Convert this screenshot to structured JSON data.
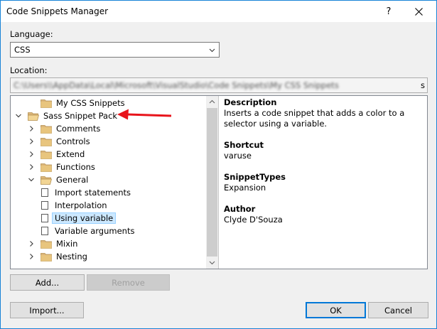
{
  "window": {
    "title": "Code Snippets Manager",
    "help_glyph": "?",
    "border_color": "#1883d7"
  },
  "language": {
    "label": "Language:",
    "selected": "CSS"
  },
  "location": {
    "label": "Location:",
    "value_blurred": "C:\\Users\\\\AppData\\Local\\Microsoft\\VisualStudio\\Code Snippets\\My CSS Snippets",
    "visible_end": "s"
  },
  "tree": {
    "items": [
      {
        "label": "My CSS Snippets",
        "type": "folder",
        "level": 1,
        "expander": "none"
      },
      {
        "label": "Sass Snippet Pack",
        "type": "folder-open",
        "level": 0,
        "expander": "expanded"
      },
      {
        "label": "Comments",
        "type": "folder",
        "level": 1,
        "expander": "collapsed"
      },
      {
        "label": "Controls",
        "type": "folder",
        "level": 1,
        "expander": "collapsed"
      },
      {
        "label": "Extend",
        "type": "folder",
        "level": 1,
        "expander": "collapsed"
      },
      {
        "label": "Functions",
        "type": "folder",
        "level": 1,
        "expander": "collapsed"
      },
      {
        "label": "General",
        "type": "folder-open",
        "level": 1,
        "expander": "expanded"
      },
      {
        "label": "Import statements",
        "type": "snippet",
        "level": 2
      },
      {
        "label": "Interpolation",
        "type": "snippet",
        "level": 2
      },
      {
        "label": "Using variable",
        "type": "snippet",
        "level": 2,
        "selected": true
      },
      {
        "label": "Variable arguments",
        "type": "snippet",
        "level": 2
      },
      {
        "label": "Mixin",
        "type": "folder",
        "level": 1,
        "expander": "collapsed"
      },
      {
        "label": "Nesting",
        "type": "folder",
        "level": 1,
        "expander": "collapsed"
      }
    ],
    "selection_color": "#cce8ff",
    "folder_color": "#dcb67a"
  },
  "details": {
    "description_label": "Description",
    "description": "Inserts a code snippet that adds a color to a selector using a variable.",
    "shortcut_label": "Shortcut",
    "shortcut": "varuse",
    "types_label": "SnippetTypes",
    "types": "Expansion",
    "author_label": "Author",
    "author": "Clyde D'Souza"
  },
  "buttons": {
    "add": "Add...",
    "remove": "Remove",
    "import": "Import...",
    "ok": "OK",
    "cancel": "Cancel"
  },
  "annotation": {
    "arrow_color": "#e8141b"
  }
}
